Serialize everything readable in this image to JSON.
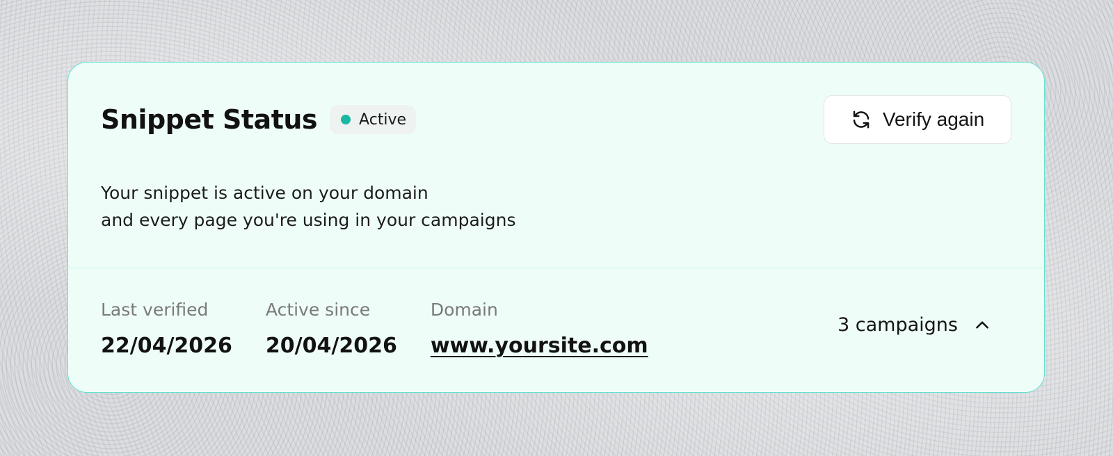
{
  "card": {
    "title": "Snippet Status",
    "status_badge": {
      "label": "Active",
      "color": "#19b8a2"
    },
    "verify_button": {
      "label": "Verify again",
      "icon": "refresh-icon"
    },
    "description": {
      "line1": "Your snippet is active on your domain",
      "line2": "and every page you're using in your campaigns"
    },
    "meta": {
      "last_verified": {
        "label": "Last verified",
        "value": "22/04/2026"
      },
      "active_since": {
        "label": "Active since",
        "value": "20/04/2026"
      },
      "domain": {
        "label": "Domain",
        "value": "www.yoursite.com"
      }
    },
    "campaigns_toggle": {
      "label": "3 campaigns",
      "icon": "chevron-up-icon",
      "expanded": true
    }
  },
  "colors": {
    "accent": "#19b8a2",
    "card_border": "#5fe3cf",
    "card_background": "#effdf9"
  }
}
